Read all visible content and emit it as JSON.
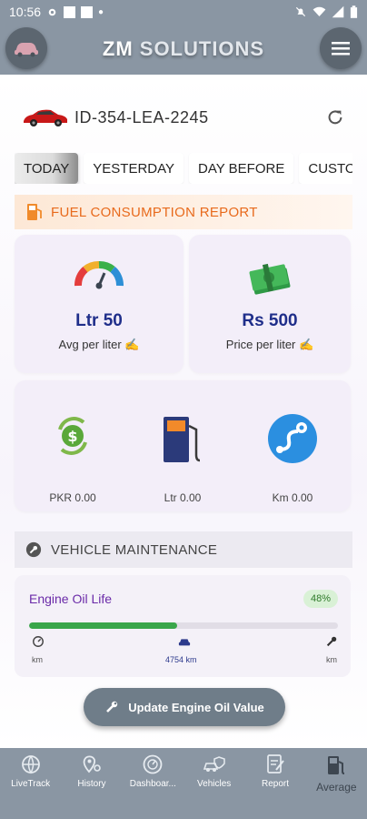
{
  "status_bar": {
    "time": "10:56"
  },
  "header": {
    "title_main": "ZM ",
    "title_dim": "SOLUTIONS"
  },
  "vehicle": {
    "id": "ID-354-LEA-2245"
  },
  "tabs": [
    "TODAY",
    "YESTERDAY",
    "DAY BEFORE",
    "CUSTO"
  ],
  "fuel": {
    "title": "FUEL CONSUMPTION REPORT",
    "avg": {
      "value": "Ltr 50",
      "label": "Avg per liter ✍️"
    },
    "price": {
      "value": "Rs 500",
      "label": "Price per liter ✍️"
    },
    "stats": [
      {
        "icon": "money-refresh-icon",
        "label": "PKR 0.00"
      },
      {
        "icon": "fuel-pump-icon",
        "label": "Ltr 0.00"
      },
      {
        "icon": "route-icon",
        "label": "Km 0.00"
      }
    ]
  },
  "maintenance": {
    "title": "VEHICLE MAINTENANCE",
    "oil": {
      "title": "Engine Oil Life",
      "percent_label": "48%",
      "percent": 48,
      "left_label": "km",
      "mid_label": "4754 km",
      "right_label": "km"
    },
    "update_button": "Update Engine Oil Value"
  },
  "nav": [
    {
      "icon": "globe-icon",
      "label": "LiveTrack"
    },
    {
      "icon": "map-pin-icon",
      "label": "History"
    },
    {
      "icon": "dashboard-icon",
      "label": "Dashboar..."
    },
    {
      "icon": "vehicles-icon",
      "label": "Vehicles"
    },
    {
      "icon": "report-icon",
      "label": "Report"
    },
    {
      "icon": "fuel-station-icon",
      "label": "Average"
    }
  ],
  "colors": {
    "bar": "#8a96a3",
    "accent_orange": "#e86a1c",
    "value_blue": "#1f2e8a",
    "progress": "#3aa64a"
  }
}
